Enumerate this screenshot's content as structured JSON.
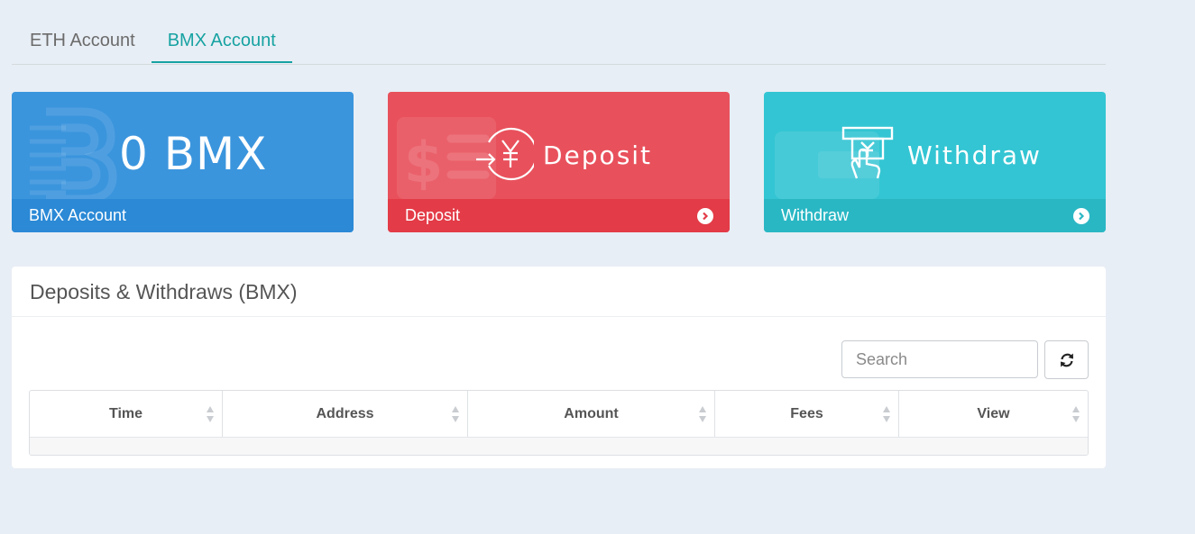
{
  "tabs": [
    {
      "label": "ETH Account",
      "active": false
    },
    {
      "label": "BMX Account",
      "active": true
    }
  ],
  "cards": {
    "balance": {
      "value": "0 BMX",
      "footer": "BMX Account",
      "color": "#3b95dd"
    },
    "deposit": {
      "title": "Deposit",
      "footer": "Deposit",
      "color": "#e8515c",
      "icon": "yuan-exchange-icon"
    },
    "withdraw": {
      "title": "Withdraw",
      "footer": "Withdraw",
      "color": "#33c5d3",
      "icon": "atm-hand-icon"
    }
  },
  "panel": {
    "title": "Deposits & Withdraws (BMX)",
    "search_placeholder": "Search",
    "refresh_icon": "refresh-icon",
    "columns": [
      "Time",
      "Address",
      "Amount",
      "Fees",
      "View"
    ],
    "rows": []
  },
  "colors": {
    "accent": "#17a2a2",
    "background": "#e8eef5"
  }
}
